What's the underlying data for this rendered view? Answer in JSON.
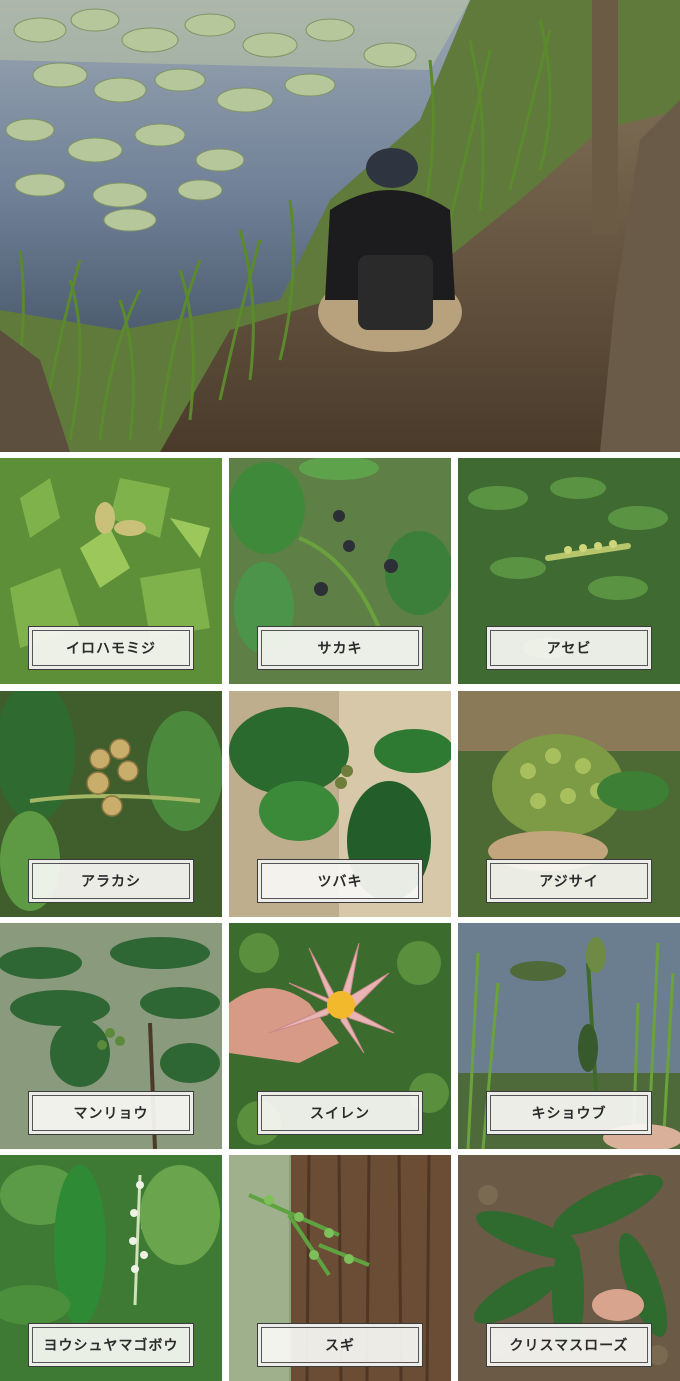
{
  "hero": {
    "icon": "pond-photo"
  },
  "plants": [
    {
      "name": "イロハモミジ",
      "photo": "maple-leaves-photo"
    },
    {
      "name": "サカキ",
      "photo": "sakaki-berries-photo"
    },
    {
      "name": "アセビ",
      "photo": "asebi-shrub-photo"
    },
    {
      "name": "アラカシ",
      "photo": "oak-acorns-photo"
    },
    {
      "name": "ツバキ",
      "photo": "camellia-leaves-photo"
    },
    {
      "name": "アジサイ",
      "photo": "hydrangea-bud-photo"
    },
    {
      "name": "マンリョウ",
      "photo": "manryo-shrub-photo"
    },
    {
      "name": "スイレン",
      "photo": "water-lily-flower-photo"
    },
    {
      "name": "キショウブ",
      "photo": "yellow-iris-pods-photo"
    },
    {
      "name": "ヨウシュヤマゴボウ",
      "photo": "pokeweed-photo"
    },
    {
      "name": "スギ",
      "photo": "cedar-trunk-photo"
    },
    {
      "name": "クリスマスローズ",
      "photo": "christmas-rose-photo"
    }
  ]
}
